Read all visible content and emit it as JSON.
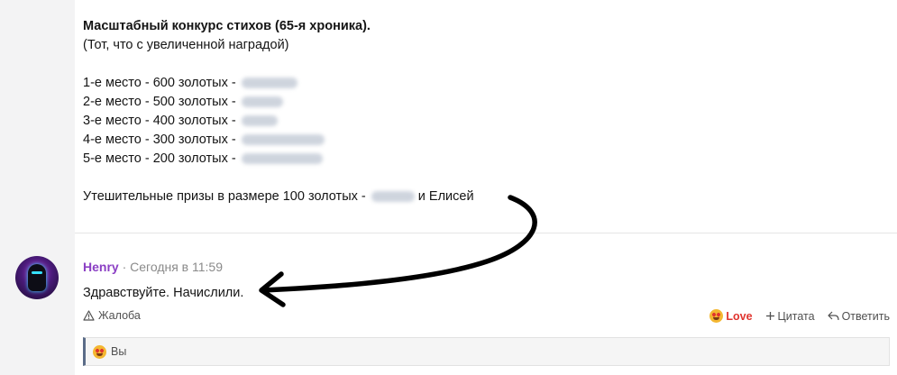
{
  "post": {
    "title": "Масштабный конкурс стихов (65-я хроника).",
    "subtitle": "(Тот, что с увеличенной наградой)",
    "places": [
      "1-е место - 600 золотых -",
      "2-е место - 500 золотых -",
      "3-е место - 400 золотых -",
      "4-е место - 300 золотых -",
      "5-е место - 200 золотых -"
    ],
    "consolation_prefix": "Утешительные призы в размере 100 золотых -",
    "consolation_suffix": "и Елисей"
  },
  "reply": {
    "author": "Henry",
    "separator": "·",
    "time": "Сегодня в 11:59",
    "text": "Здравствуйте. Начислили."
  },
  "actions": {
    "report": "Жалоба",
    "love": "Love",
    "quote": "Цитата",
    "reply": "Ответить"
  },
  "reactions": {
    "label": "Вы"
  },
  "icons": {
    "report": "warning-triangle-icon",
    "love": "heart-eyes-emoji-icon",
    "quote": "plus-icon",
    "reply": "reply-arrow-icon"
  },
  "colors": {
    "author": "#8b3fc4",
    "love": "#e0342e",
    "gutter": "#f3f3f4",
    "reaction_border": "#5b6c88"
  }
}
